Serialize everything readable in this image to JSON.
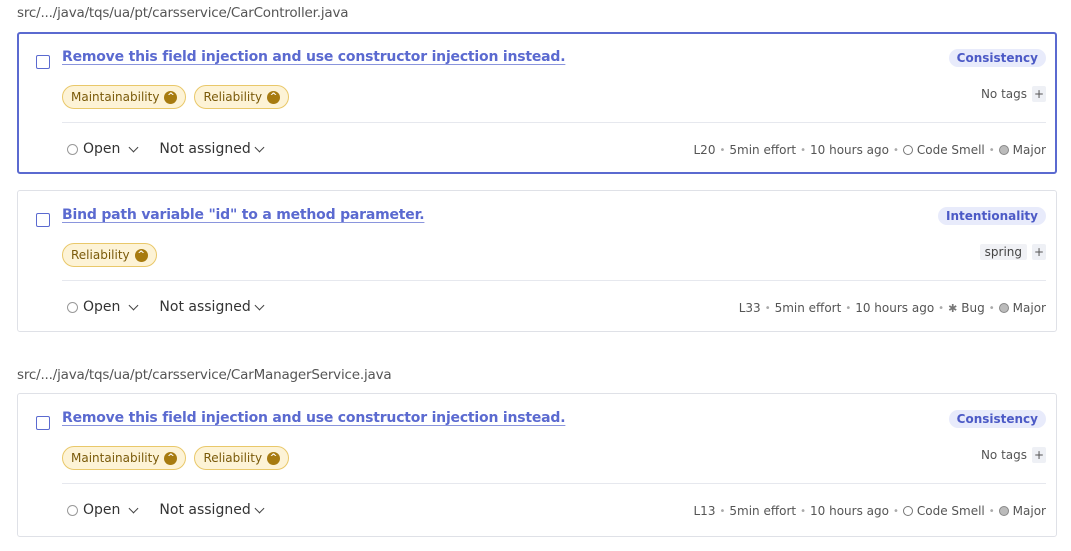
{
  "groups": [
    {
      "file_path": "src/.../java/tqs/ua/pt/carsservice/CarController.java",
      "issues": [
        {
          "title": "Remove this field injection and use constructor injection instead.",
          "attribute": "Consistency",
          "qualities": [
            "Maintainability",
            "Reliability"
          ],
          "tags_label": "No tags",
          "status": "Open",
          "assignee": "Not assigned",
          "line": "L20",
          "effort": "5min effort",
          "time": "10 hours ago",
          "type": "Code Smell",
          "severity": "Major",
          "selected": true
        },
        {
          "title": "Bind path variable \"id\" to a method parameter.",
          "attribute": "Intentionality",
          "qualities": [
            "Reliability"
          ],
          "tags_label": "spring",
          "status": "Open",
          "assignee": "Not assigned",
          "line": "L33",
          "effort": "5min effort",
          "time": "10 hours ago",
          "type": "Bug",
          "severity": "Major",
          "selected": false
        }
      ]
    },
    {
      "file_path": "src/.../java/tqs/ua/pt/carsservice/CarManagerService.java",
      "issues": [
        {
          "title": "Remove this field injection and use constructor injection instead.",
          "attribute": "Consistency",
          "qualities": [
            "Maintainability",
            "Reliability"
          ],
          "tags_label": "No tags",
          "status": "Open",
          "assignee": "Not assigned",
          "line": "L13",
          "effort": "5min effort",
          "time": "10 hours ago",
          "type": "Code Smell",
          "severity": "Major",
          "selected": false
        }
      ]
    }
  ],
  "colors": {
    "accent": "#5b6ad0",
    "quality_bg": "#fdf3d6",
    "quality_border": "#e9c86a"
  },
  "icons": {
    "add_tag": "+",
    "quality": "chevron-up-icon"
  }
}
